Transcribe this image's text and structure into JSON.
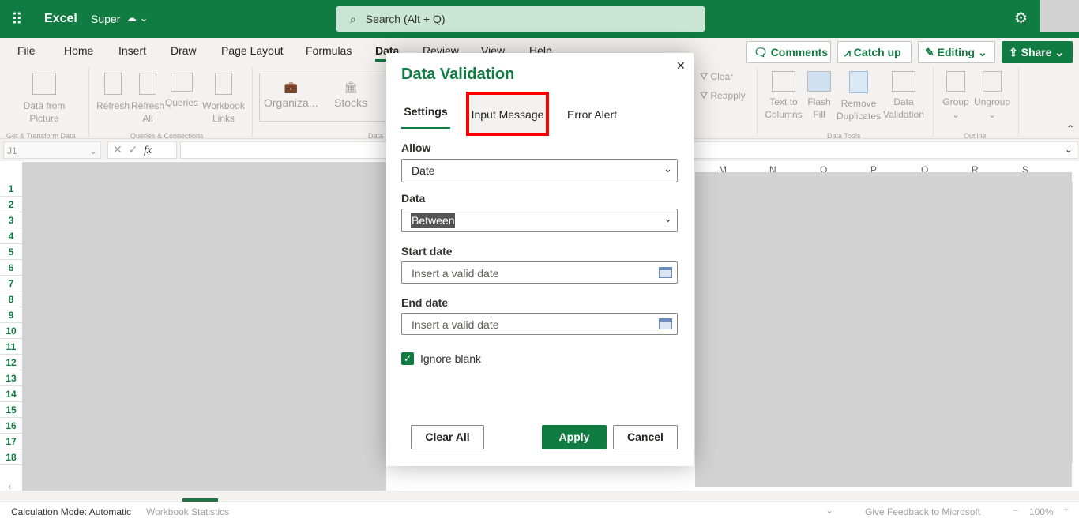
{
  "app": {
    "name": "Excel",
    "file": "Super",
    "search_placeholder": "Search (Alt + Q)"
  },
  "menu": [
    "File",
    "Home",
    "Insert",
    "Draw",
    "Page Layout",
    "Formulas",
    "Data",
    "Review",
    "View",
    "Help"
  ],
  "header_buttons": {
    "comments": "Comments",
    "catch_up": "Catch up",
    "editing": "Editing",
    "share": "Share"
  },
  "ribbon": {
    "data_from_picture": "Data from Picture",
    "refresh": "Refresh",
    "refresh_all": "Refresh All",
    "queries": "Queries",
    "workbook_links": "Workbook Links",
    "organiza": "Organiza...",
    "stocks": "Stocks",
    "clear": "Clear",
    "reapply": "Reapply",
    "text_to_columns": "Text to Columns",
    "flash_fill": "Flash Fill",
    "remove_duplicates": "Remove Duplicates",
    "data_validation": "Data Validation",
    "group": "Group",
    "ungroup": "Ungroup",
    "groups": {
      "get_transform": "Get & Transform Data",
      "queries_connections": "Queries & Connections",
      "data_types": "Data",
      "data_tools": "Data Tools",
      "outline": "Outline"
    }
  },
  "formula_bar": {
    "name_box": "J1",
    "fx": "fx"
  },
  "columns": [
    "M",
    "N",
    "O",
    "P",
    "Q",
    "R",
    "S"
  ],
  "rows": [
    "1",
    "2",
    "3",
    "4",
    "5",
    "6",
    "7",
    "8",
    "9",
    "10",
    "11",
    "12",
    "13",
    "14",
    "15",
    "16",
    "17",
    "18"
  ],
  "dialog": {
    "title": "Data Validation",
    "tabs": [
      "Settings",
      "Input Message",
      "Error Alert"
    ],
    "allow_label": "Allow",
    "allow_value": "Date",
    "data_label": "Data",
    "data_value": "Between",
    "start_label": "Start date",
    "start_placeholder": "Insert a valid date",
    "end_label": "End date",
    "end_placeholder": "Insert a valid date",
    "ignore_blank": "Ignore blank",
    "ignore_blank_checked": true,
    "clear_all": "Clear All",
    "apply": "Apply",
    "cancel": "Cancel"
  },
  "status": {
    "calc_mode": "Calculation Mode: Automatic",
    "workbook_stats": "Workbook Statistics",
    "feedback": "Give Feedback to Microsoft",
    "zoom": "100%"
  },
  "colors": {
    "brand": "#107c41",
    "highlight": "#ff0000"
  }
}
